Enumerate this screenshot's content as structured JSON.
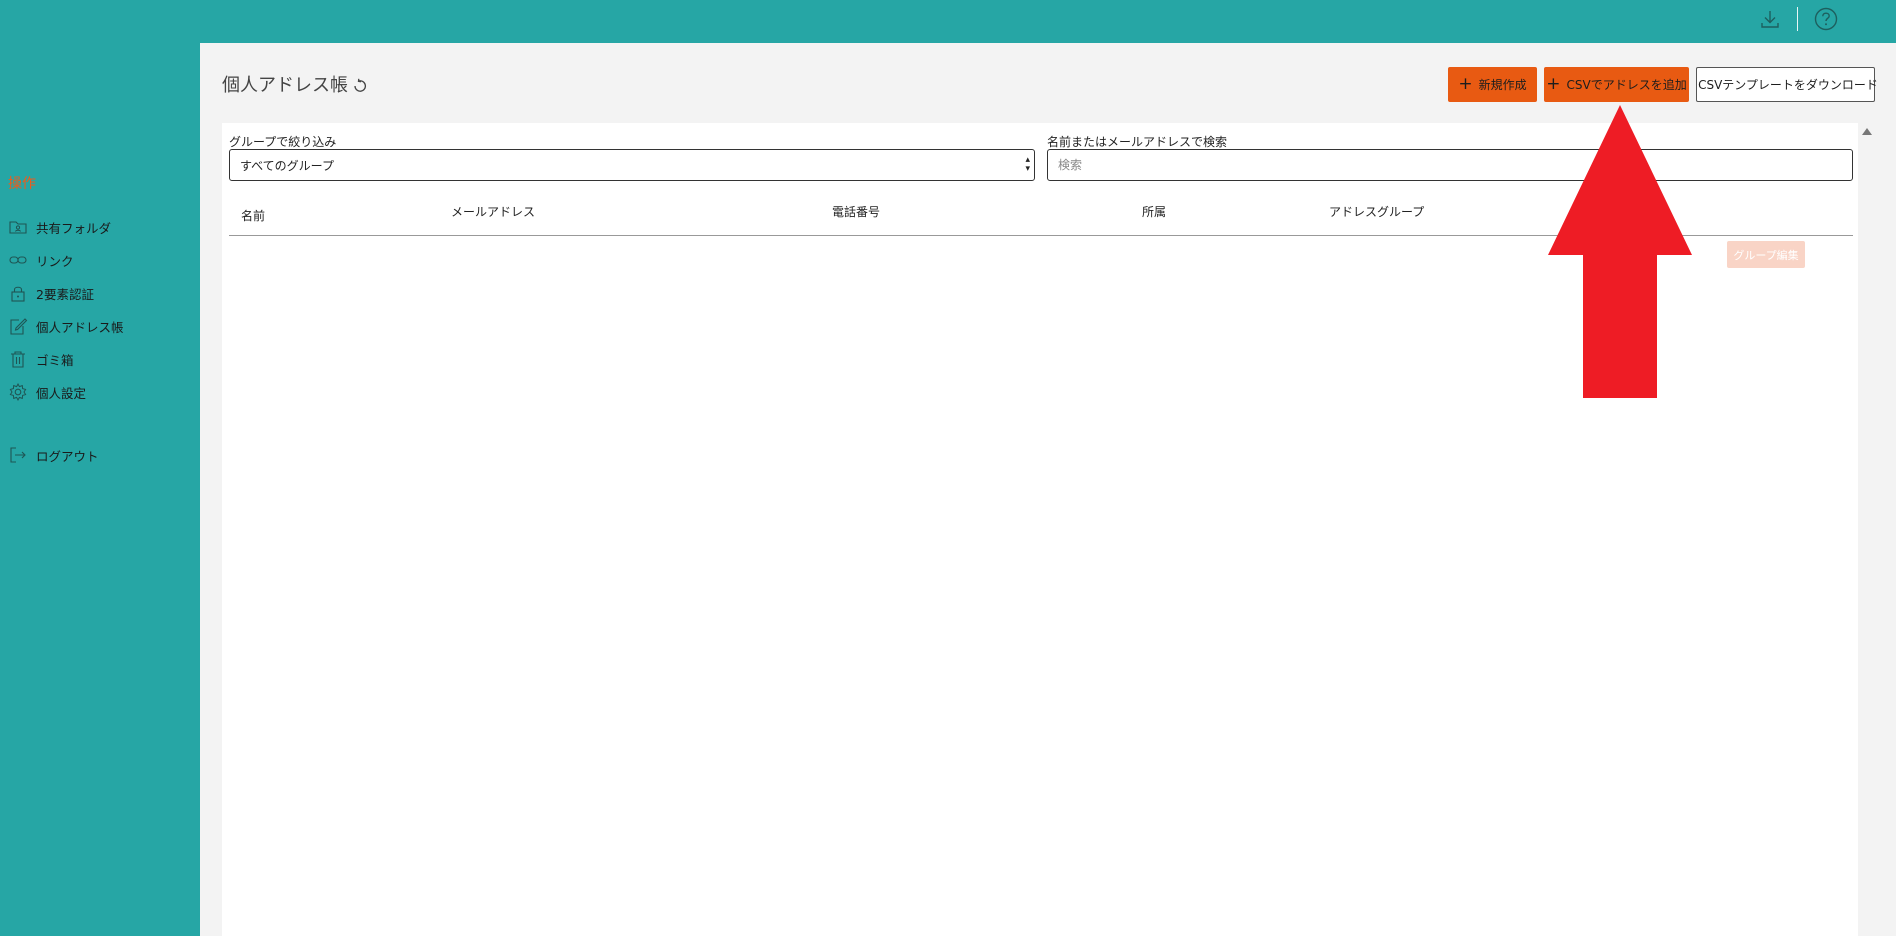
{
  "topbar": {
    "download_icon": "download-icon",
    "help_icon": "help-circle-icon"
  },
  "sidebar": {
    "section_title": "操作",
    "items": [
      {
        "label": "共有フォルダ",
        "icon": "folder-user-icon"
      },
      {
        "label": "リンク",
        "icon": "link-icon"
      },
      {
        "label": "2要素認証",
        "icon": "lock-icon"
      },
      {
        "label": "個人アドレス帳",
        "icon": "edit-icon"
      },
      {
        "label": "ゴミ箱",
        "icon": "trash-icon"
      },
      {
        "label": "個人設定",
        "icon": "gear-icon"
      },
      {
        "label": "ログアウト",
        "icon": "logout-icon"
      }
    ]
  },
  "main": {
    "title": "個人アドレス帳",
    "buttons": {
      "new": "新規作成",
      "csv_add": "CSVでアドレスを追加",
      "csv_template": "CSVテンプレートをダウンロード"
    },
    "filter": {
      "group_label": "グループで絞り込み",
      "group_selected": "すべてのグループ",
      "search_label": "名前またはメールアドレスで検索",
      "search_placeholder": "検索",
      "search_value": ""
    },
    "table": {
      "columns": [
        "名前",
        "メールアドレス",
        "電話番号",
        "所属",
        "アドレスグループ"
      ],
      "group_edit_label": "グループ編集",
      "rows": []
    }
  },
  "colors": {
    "teal": "#26a6a5",
    "accent_orange": "#e85a12",
    "annotation_red": "#ee1c25"
  }
}
